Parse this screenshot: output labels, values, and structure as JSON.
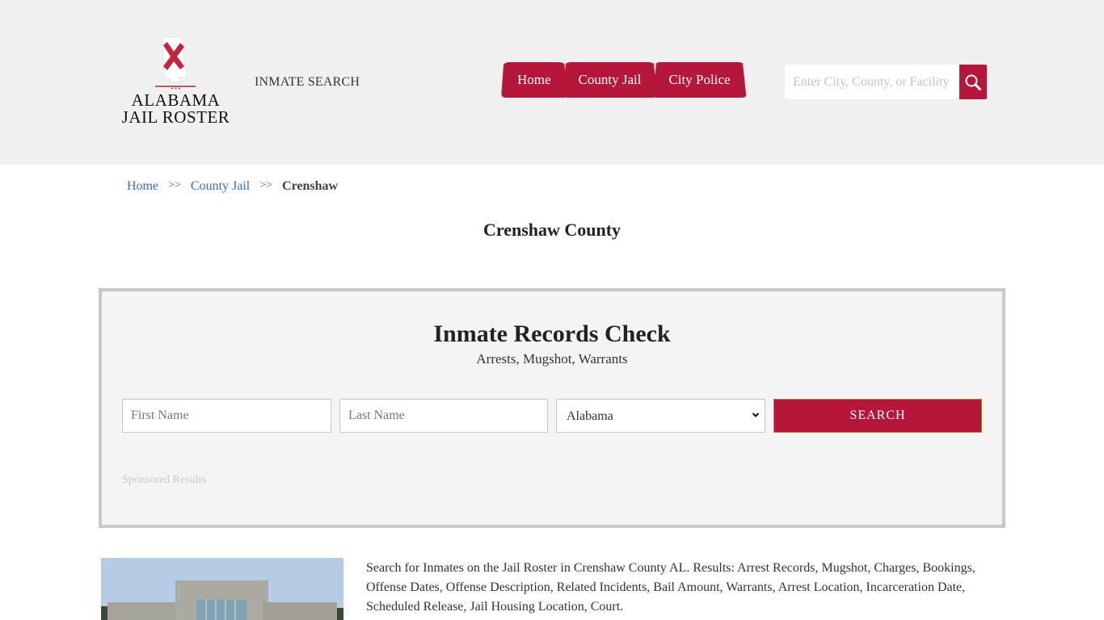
{
  "header": {
    "logo": {
      "line1": "ALABAMA",
      "line2": "JAIL ROSTER",
      "icon": "alabama-map-icon"
    },
    "inmate_search_label": "INMATE SEARCH",
    "nav": [
      {
        "label": "Home"
      },
      {
        "label": "County Jail"
      },
      {
        "label": "City Police"
      }
    ],
    "search": {
      "placeholder": "Enter City, County, or Facility",
      "value": "",
      "icon": "search-icon"
    }
  },
  "breadcrumb": {
    "items": [
      {
        "label": "Home"
      },
      {
        "label": "County Jail"
      }
    ],
    "separator": ">>",
    "current": "Crenshaw"
  },
  "page_title": "Crenshaw County",
  "records_check": {
    "title": "Inmate Records Check",
    "subtitle": "Arrests, Mugshot, Warrants",
    "first_name_placeholder": "First Name",
    "last_name_placeholder": "Last Name",
    "state_selected": "Alabama",
    "search_button": "SEARCH",
    "sponsored_label": "Sponsored Results"
  },
  "content": {
    "image_alt": "Crenshaw County Jail building",
    "description": "Search for Inmates on the Jail Roster in Crenshaw County AL. Results: Arrest Records, Mugshot, Charges, Bookings, Offense Dates, Offense Description, Related Incidents, Bail Amount, Warrants, Arrest Location, Incarceration Date, Scheduled Release, Jail Housing Location, Court."
  },
  "colors": {
    "brand_red": "#b5173b",
    "link_blue": "#3a6bd1",
    "header_bg": "#f0f0f0",
    "box_bg": "#f4f4f4"
  }
}
